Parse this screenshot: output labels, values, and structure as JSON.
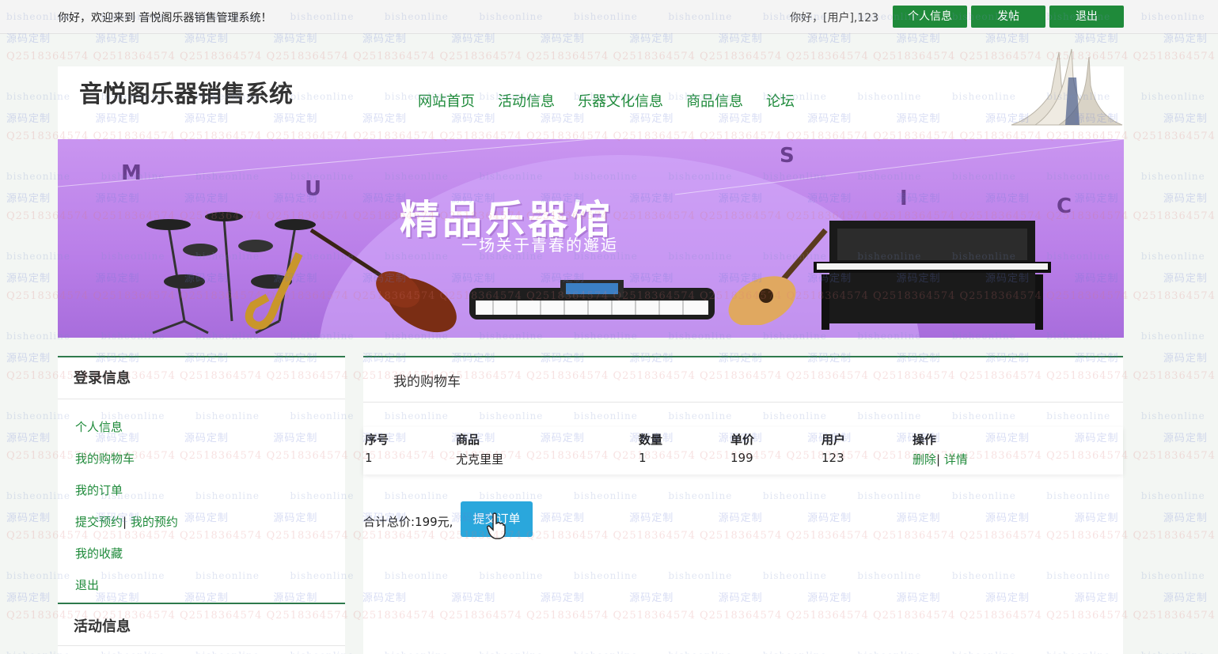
{
  "topbar": {
    "welcome": "你好，欢迎来到 音悦阁乐器销售管理系统！",
    "greeting": "你好，[用户],123",
    "buttons": [
      "个人信息",
      "发帖",
      "退出"
    ]
  },
  "header": {
    "site_title": "音悦阁乐器销售系统",
    "nav": [
      "网站首页",
      "活动信息",
      "乐器文化信息",
      "商品信息",
      "论坛"
    ]
  },
  "banner": {
    "title": "精品乐器馆",
    "subtitle": "一场关于青春的邂逅",
    "letters": [
      "M",
      "U",
      "S",
      "I",
      "C"
    ]
  },
  "sidebar": {
    "login_heading": "登录信息",
    "links": [
      "个人信息",
      "我的购物车",
      "我的订单",
      "提交预约",
      "我的预约",
      "我的收藏",
      "退出"
    ],
    "activity_heading": "活动信息"
  },
  "cart": {
    "title": "我的购物车",
    "columns": [
      "序号",
      "商品",
      "数量",
      "单价",
      "用户",
      "操作"
    ],
    "rows": [
      {
        "index": "1",
        "product": "尤克里里",
        "quantity": "1",
        "price": "199",
        "user": "123",
        "actions": [
          "删除",
          "详情"
        ]
      }
    ],
    "total_text": "合计总价:199元,",
    "submit_label": "提交订单"
  },
  "watermark": {
    "text1": "bisheonline",
    "text2": "源码定制",
    "text3": "Q2518364574"
  }
}
